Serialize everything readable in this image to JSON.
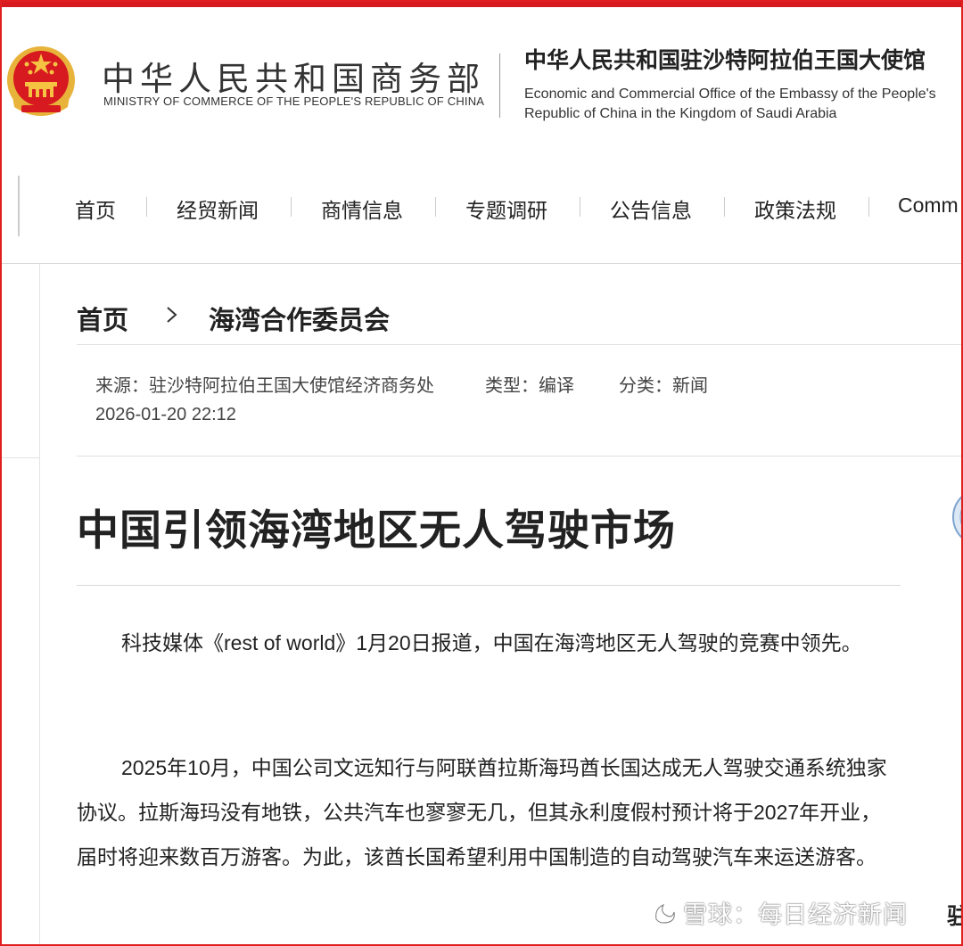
{
  "header": {
    "mofcom_cn": "中华人民共和国商务部",
    "mofcom_en": "MINISTRY OF COMMERCE OF THE PEOPLE'S REPUBLIC OF CHINA",
    "office_cn": "中华人民共和国驻沙特阿拉伯王国大使馆",
    "office_en": "Economic and Commercial Office of the Embassy of the People's Republic of China in the Kingdom of Saudi Arabia",
    "emblem_icon": "national-emblem-icon"
  },
  "nav": {
    "items": [
      "首页",
      "经贸新闻",
      "商情信息",
      "专题调研",
      "公告信息",
      "政策法规",
      "Comm"
    ]
  },
  "breadcrumb": {
    "home": "首页",
    "current": "海湾合作委员会"
  },
  "meta": {
    "source": "来源：驻沙特阿拉伯王国大使馆经济商务处",
    "type": "类型：编译",
    "category": "分类：新闻",
    "datetime": "2026-01-20 22:12"
  },
  "article": {
    "title": "中国引领海湾地区无人驾驶市场",
    "paragraphs": [
      "科技媒体《rest of world》1月20日报道，中国在海湾地区无人驾驶的竞赛中领先。",
      "2025年10月，中国公司文远知行与阿联酋拉斯海玛酋长国达成无人驾驶交通系统独家协议。拉斯海玛没有地铁，公共汽车也寥寥无几，但其永利度假村预计将于2027年开业，届时将迎来数百万游客。为此，该酋长国希望利用中国制造的自动驾驶汽车来运送游客。"
    ]
  },
  "watermark": {
    "text": "雪球：每日经济新闻",
    "edge_char": "驻"
  },
  "colors": {
    "brand_red": "#d71920",
    "frame_red": "#e02020",
    "text": "#222222"
  }
}
